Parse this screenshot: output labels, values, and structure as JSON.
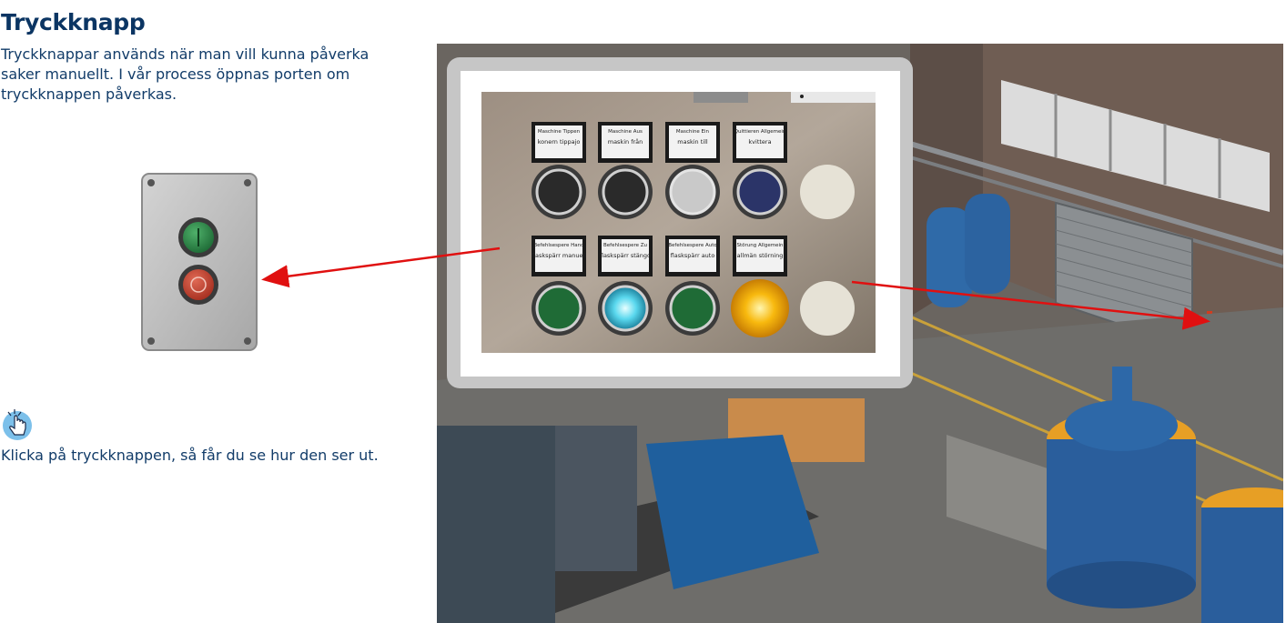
{
  "page": {
    "title": "Tryckknapp",
    "intro": "Tryckknappar används när man vill kunna påverka saker manuellt. I vår process öppnas porten om tryckknappen påverkas.",
    "hint": "Klicka på tryckknappen, så får du se hur den ser ut."
  },
  "icons": {
    "hint": "pointer-hand-icon",
    "pushbutton": "pushbutton-box-icon"
  },
  "panel": {
    "top_row": [
      {
        "label_small": "Maschine Tippen",
        "label": "konern tippajo",
        "color": "#2a2a2a"
      },
      {
        "label_small": "Maschine Aus",
        "label": "maskin från",
        "color": "#2a2a2a"
      },
      {
        "label_small": "Maschine Ein",
        "label": "maskin till",
        "color": "#c9c9c9"
      },
      {
        "label_small": "Quittieren Allgemein",
        "label": "kvittera",
        "color": "#2b3468"
      }
    ],
    "bottom_row": [
      {
        "label_small": "Befehlsespere Hand",
        "label": "flaskspärr manuell",
        "color": "#1f6b36"
      },
      {
        "label_small": "Befehlsespere Zu",
        "label": "flaskspärr stängd",
        "color": "#4fd8f0"
      },
      {
        "label_small": "Befehlsespere Auto",
        "label": "flaskspärr auto",
        "color": "#1f6b36"
      },
      {
        "label_small": "Störung Allgemein",
        "label": "allmän störning",
        "color": "#f5b20a"
      }
    ]
  },
  "colors": {
    "heading": "#0b3563",
    "text": "#123c69",
    "arrow": "#e01010",
    "pushbox_grey": "#b7b7b7",
    "start_green": "#2e8a4a",
    "stop_red": "#c9432f"
  }
}
